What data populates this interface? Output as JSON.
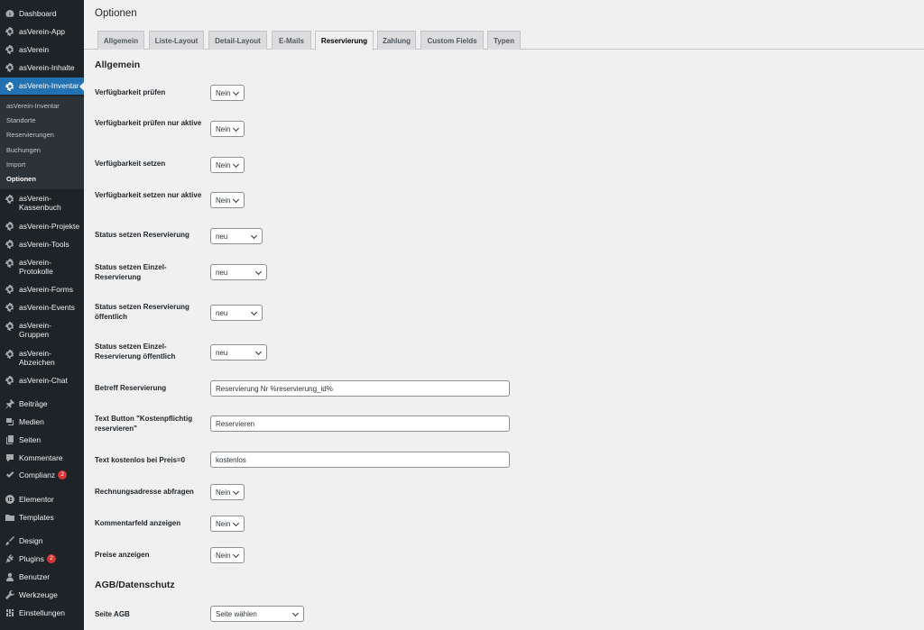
{
  "sidebar": {
    "items": [
      {
        "label": "Dashboard",
        "icon": "dashboard-icon"
      },
      {
        "label": "asVerein-App",
        "icon": "gear-icon"
      },
      {
        "label": "asVerein",
        "icon": "gear-icon"
      },
      {
        "label": "asVerein-Inhalte",
        "icon": "gear-icon"
      },
      {
        "label": "asVerein-Inventar",
        "icon": "gear-icon",
        "current": true
      },
      {
        "label": "asVerein-Kassenbuch",
        "icon": "gear-icon"
      },
      {
        "label": "asVerein-Projekte",
        "icon": "gear-icon"
      },
      {
        "label": "asVerein-Tools",
        "icon": "gear-icon"
      },
      {
        "label": "asVerein-Protokolle",
        "icon": "gear-icon"
      },
      {
        "label": "asVerein-Forms",
        "icon": "gear-icon"
      },
      {
        "label": "asVerein-Events",
        "icon": "gear-icon"
      },
      {
        "label": "asVerein-Gruppen",
        "icon": "gear-icon"
      },
      {
        "label": "asVerein-Abzeichen",
        "icon": "gear-icon"
      },
      {
        "label": "asVerein-Chat",
        "icon": "gear-icon"
      },
      {
        "label": "Beiträge",
        "icon": "pin-icon"
      },
      {
        "label": "Medien",
        "icon": "media-icon"
      },
      {
        "label": "Seiten",
        "icon": "pages-icon"
      },
      {
        "label": "Kommentare",
        "icon": "comment-icon"
      },
      {
        "label": "Complianz",
        "icon": "check-icon",
        "badge": "2"
      },
      {
        "label": "Elementor",
        "icon": "elementor-icon"
      },
      {
        "label": "Templates",
        "icon": "folder-icon"
      },
      {
        "label": "Design",
        "icon": "brush-icon"
      },
      {
        "label": "Plugins",
        "icon": "plugin-icon",
        "badge": "2"
      },
      {
        "label": "Benutzer",
        "icon": "user-icon"
      },
      {
        "label": "Werkzeuge",
        "icon": "wrench-icon"
      },
      {
        "label": "Einstellungen",
        "icon": "settings-icon"
      }
    ],
    "submenu": [
      "asVerein-Inventar",
      "Standorte",
      "Reservierungen",
      "Buchungen",
      "Import",
      "Optionen"
    ],
    "submenu_active": "Optionen"
  },
  "page": {
    "title": "Optionen",
    "tabs": [
      "Allgemein",
      "Liste-Layout",
      "Detail-Layout",
      "E-Mails",
      "Reservierung",
      "Zahlung",
      "Custom Fields",
      "Typen"
    ],
    "active_tab": "Reservierung"
  },
  "sections": {
    "allgemein": "Allgemein",
    "agb": "AGB/Datenschutz"
  },
  "fields": [
    {
      "label": "Verfügbarkeit prüfen",
      "type": "select",
      "value": "Nein"
    },
    {
      "label": "Verfügbarkeit prüfen nur aktive",
      "type": "select",
      "value": "Nein"
    },
    {
      "label": "Verfügbarkeit setzen",
      "type": "select",
      "value": "Nein"
    },
    {
      "label": "Verfügbarkeit setzen nur aktive",
      "type": "select",
      "value": "Nein"
    },
    {
      "label": "Status setzen Reservierung",
      "type": "select",
      "value": "neu"
    },
    {
      "label": "Status setzen Einzel-Reservierung",
      "type": "select",
      "value": "neu"
    },
    {
      "label": "Status setzen Reservierung öffentlich",
      "type": "select",
      "value": "neu"
    },
    {
      "label": "Status setzen Einzel-Reservierung öffentlich",
      "type": "select",
      "value": "neu"
    },
    {
      "label": "Betreff Reservierung",
      "type": "text",
      "value": "Reservierung Nr %reservierung_id%"
    },
    {
      "label": "Text Button \"Kostenpflichtig reservieren\"",
      "type": "text",
      "value": "Reservieren"
    },
    {
      "label": "Text kostenlos bei Preis=0",
      "type": "text",
      "value": "kostenlos"
    },
    {
      "label": "Rechnungsadresse abfragen",
      "type": "select",
      "value": "Nein"
    },
    {
      "label": "Kommentarfeld anzeigen",
      "type": "select",
      "value": "Nein"
    },
    {
      "label": "Preise anzeigen",
      "type": "select",
      "value": "Nein"
    },
    {
      "label": "Seite AGB",
      "type": "select",
      "value": "Seite wählen"
    }
  ],
  "colors": {
    "sidebar_bg": "#1d2327",
    "submenu_bg": "#2c3338",
    "accent": "#2271b1",
    "badge": "#d63638",
    "page_bg": "#f0f0f1"
  }
}
